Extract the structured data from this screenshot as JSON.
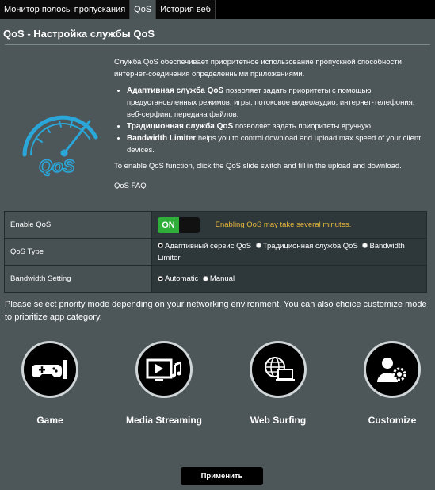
{
  "tabs": [
    "Монитор полосы пропускания",
    "QoS",
    "История веб"
  ],
  "active_tab": "QoS",
  "title": "QoS - Настройка службы QoS",
  "intro": "Служба QoS обеспечивает приоритетное использование пропускной способности интернет-соединения определенными приложениями.",
  "bullets": [
    {
      "bold": "Адаптивная служба QoS",
      "text": " позволяет задать приоритеты с помощью предустановленных режимов: игры, потоковое видео/аудио, интернет-телефония, веб-серфинг, передача файлов."
    },
    {
      "bold": "Традиционная служба QoS",
      "text": " позволяет задать приоритеты вручную."
    },
    {
      "bold": "Bandwidth Limiter",
      "text": " helps you to control download and upload max speed of your client devices."
    }
  ],
  "enable_hint": "To enable QoS function, click the QoS slide switch and fill in the upload and download.",
  "faq_link": "QoS FAQ",
  "logo_text": "QoS",
  "settings": {
    "enable_qos": {
      "label": "Enable QoS",
      "toggle": "ON",
      "warning": "Enabling QoS may take several minutes."
    },
    "qos_type": {
      "label": "QoS Type",
      "options": [
        "Адаптивный сервис QoS",
        "Традиционная служба QoS",
        "Bandwidth Limiter"
      ],
      "selected": "Адаптивный сервис QoS"
    },
    "bandwidth_setting": {
      "label": "Bandwidth Setting",
      "options": [
        "Automatic",
        "Manual"
      ],
      "selected": "Automatic"
    }
  },
  "prompt": "Please select priority mode depending on your networking environment. You can also choice customize mode to prioritize app category.",
  "modes": [
    {
      "label": "Game",
      "icon": "gamepad-icon"
    },
    {
      "label": "Media Streaming",
      "icon": "media-streaming-icon"
    },
    {
      "label": "Web Surfing",
      "icon": "web-surfing-icon"
    },
    {
      "label": "Customize",
      "icon": "customize-icon"
    }
  ],
  "apply_label": "Применить",
  "colors": {
    "background": "#4d5659",
    "toggle_on": "#2fae3a",
    "warning": "#e8b83a",
    "logo": "#2aa7d8"
  }
}
